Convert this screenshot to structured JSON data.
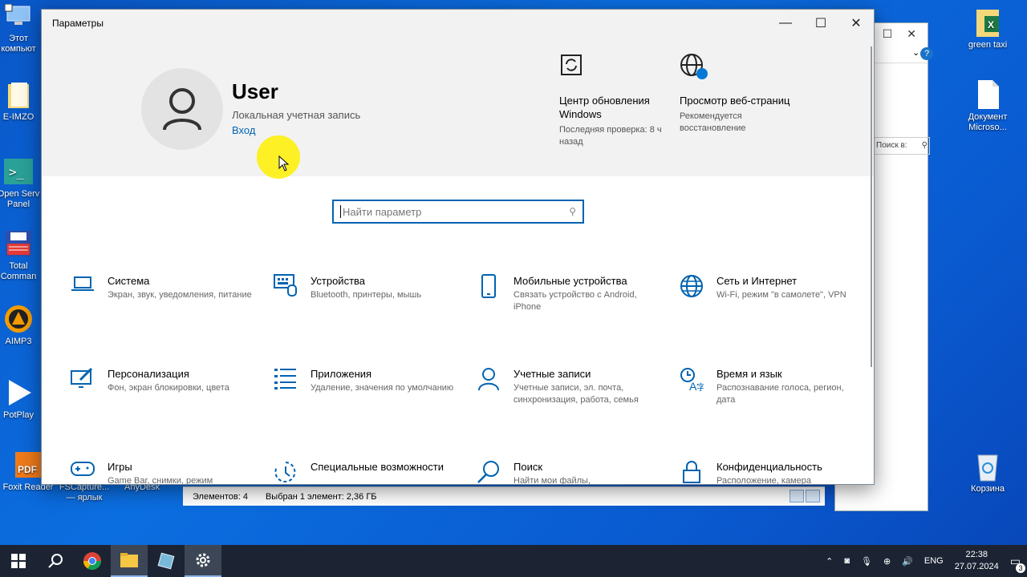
{
  "desktop": {
    "icons_left": [
      {
        "label": "Этот компьют",
        "icon": "computer-icon"
      },
      {
        "label": "E-IMZO",
        "icon": "folder-icon"
      },
      {
        "label": "Open Serv Panel",
        "icon": "terminal-icon"
      },
      {
        "label": "Total Comman",
        "icon": "floppy-icon"
      },
      {
        "label": "AIMP3",
        "icon": "aimp-icon"
      },
      {
        "label": "PotPlay",
        "icon": "play-icon"
      },
      {
        "label": "Foxit Reader",
        "icon": "pdf-icon"
      },
      {
        "label": "FSCapture... — ярлык",
        "icon": "fscapture-icon"
      },
      {
        "label": "AnyDesk",
        "icon": "anydesk-icon"
      }
    ],
    "icons_right": [
      {
        "label": "green taxi",
        "icon": "excel-icon"
      },
      {
        "label": "Документ Microso...",
        "icon": "document-icon"
      },
      {
        "label": "Корзина",
        "icon": "recycle-bin-icon"
      }
    ]
  },
  "explorer": {
    "search_placeholder": "Поиск в:",
    "status": {
      "items": "Элементов: 4",
      "selected": "Выбран 1 элемент: 2,36 ГБ"
    }
  },
  "settings": {
    "window_title": "Параметры",
    "user": {
      "name": "User",
      "account_type": "Локальная учетная запись",
      "login_link": "Вход"
    },
    "header_tiles": [
      {
        "title": "Центр обновления Windows",
        "subtitle": "Последняя проверка: 8 ч назад",
        "icon": "update-icon"
      },
      {
        "title": "Просмотр веб-страниц",
        "subtitle": "Рекомендуется восстановление",
        "icon": "globe-badge-icon"
      }
    ],
    "search": {
      "placeholder": "Найти параметр"
    },
    "categories": [
      {
        "title": "Система",
        "subtitle": "Экран, звук, уведомления, питание",
        "icon": "laptop-icon"
      },
      {
        "title": "Устройства",
        "subtitle": "Bluetooth, принтеры, мышь",
        "icon": "keyboard-icon"
      },
      {
        "title": "Мобильные устройства",
        "subtitle": "Связать устройство с Android, iPhone",
        "icon": "phone-icon"
      },
      {
        "title": "Сеть и Интернет",
        "subtitle": "Wi-Fi, режим \"в самолете\", VPN",
        "icon": "globe-icon"
      },
      {
        "title": "Персонализация",
        "subtitle": "Фон, экран блокировки, цвета",
        "icon": "paint-icon"
      },
      {
        "title": "Приложения",
        "subtitle": "Удаление, значения по умолчанию",
        "icon": "apps-list-icon"
      },
      {
        "title": "Учетные записи",
        "subtitle": "Учетные записи, эл. почта, синхронизация, работа, семья",
        "icon": "person-icon"
      },
      {
        "title": "Время и язык",
        "subtitle": "Распознавание голоса, регион, дата",
        "icon": "time-language-icon"
      },
      {
        "title": "Игры",
        "subtitle": "Game Bar, снимки, режим",
        "icon": "gamepad-icon"
      },
      {
        "title": "Специальные возможности",
        "subtitle": "",
        "icon": "accessibility-icon"
      },
      {
        "title": "Поиск",
        "subtitle": "Найти мои файлы,",
        "icon": "search-icon"
      },
      {
        "title": "Конфиденциальность",
        "subtitle": "Расположение, камера",
        "icon": "lock-icon"
      }
    ]
  },
  "taskbar": {
    "language": "ENG",
    "time": "22:38",
    "date": "27.07.2024",
    "notification_count": "3"
  },
  "colors": {
    "accent": "#0063b1",
    "desktop": "#0b6ee0",
    "taskbar": "#1c2433"
  }
}
